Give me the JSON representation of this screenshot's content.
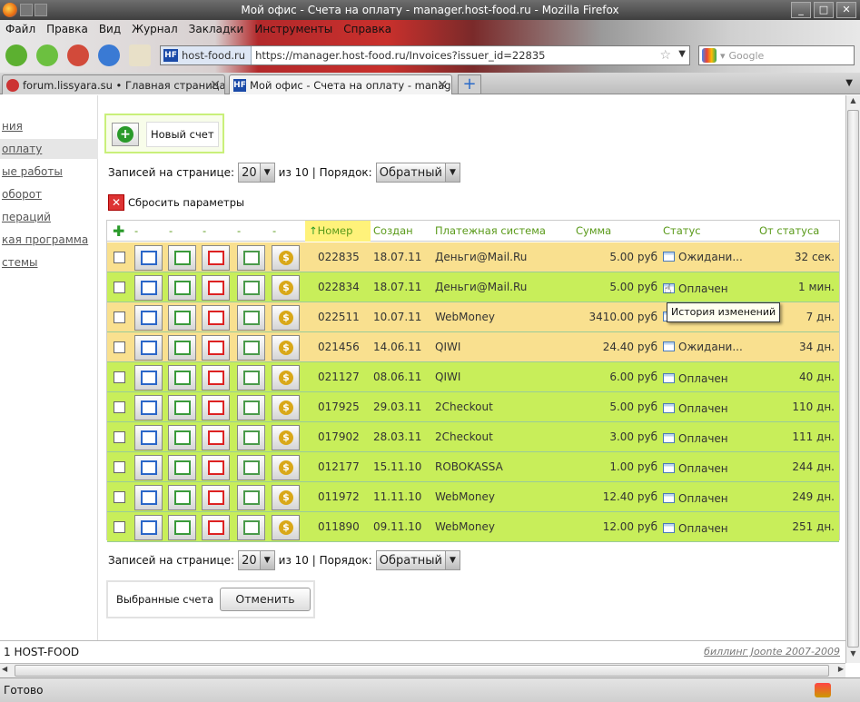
{
  "window": {
    "title": "Мой офис - Счета на оплату - manager.host-food.ru - Mozilla Firefox"
  },
  "menu": [
    "Файл",
    "Правка",
    "Вид",
    "Журнал",
    "Закладки",
    "Инструменты",
    "Справка"
  ],
  "urlbar": {
    "site": "host-food.ru",
    "url": "https://manager.host-food.ru/Invoices?issuer_id=22835"
  },
  "search": {
    "placeholder": "Google"
  },
  "tabs": [
    {
      "title": "forum.lissyara.su • Главная страница"
    },
    {
      "title": "Мой офис - Счета на оплату - manage..."
    }
  ],
  "sidebar": [
    "ния",
    "оплату",
    "ые работы",
    "оборот",
    "пераций",
    "кая программа",
    "стемы"
  ],
  "new_invoice": {
    "label": "Новый счет"
  },
  "pager": {
    "per_page_label": "Записей на странице:",
    "per_page": "20",
    "of": "из 10 | Порядок:",
    "order": "Обратный"
  },
  "reset": {
    "label": "Сбросить параметры"
  },
  "table": {
    "headers": {
      "c1": "-",
      "c2": "-",
      "c3": "-",
      "c4": "-",
      "c5": "-",
      "number": "Номер",
      "created": "Создан",
      "system": "Платежная система",
      "sum": "Сумма",
      "status": "Статус",
      "since": "От статуса"
    },
    "rows": [
      {
        "num": "022835",
        "date": "18.07.11",
        "system": "Деньги@Mail.Ru",
        "sum": "5.00 руб",
        "status": "Ожидани...",
        "since": "32 сек."
      },
      {
        "num": "022834",
        "date": "18.07.11",
        "system": "Деньги@Mail.Ru",
        "sum": "5.00 руб",
        "status": "Оплачен",
        "since": "1 мин."
      },
      {
        "num": "022511",
        "date": "10.07.11",
        "system": "WebMoney",
        "sum": "3410.00 руб",
        "status": "",
        "since": "7 дн."
      },
      {
        "num": "021456",
        "date": "14.06.11",
        "system": "QIWI",
        "sum": "24.40 руб",
        "status": "Ожидани...",
        "since": "34 дн."
      },
      {
        "num": "021127",
        "date": "08.06.11",
        "system": "QIWI",
        "sum": "6.00 руб",
        "status": "Оплачен",
        "since": "40 дн."
      },
      {
        "num": "017925",
        "date": "29.03.11",
        "system": "2Checkout",
        "sum": "5.00 руб",
        "status": "Оплачен",
        "since": "110 дн."
      },
      {
        "num": "017902",
        "date": "28.03.11",
        "system": "2Checkout",
        "sum": "3.00 руб",
        "status": "Оплачен",
        "since": "111 дн."
      },
      {
        "num": "012177",
        "date": "15.11.10",
        "system": "ROBOKASSA",
        "sum": "1.00 руб",
        "status": "Оплачен",
        "since": "244 дн."
      },
      {
        "num": "011972",
        "date": "11.11.10",
        "system": "WebMoney",
        "sum": "12.40 руб",
        "status": "Оплачен",
        "since": "249 дн."
      },
      {
        "num": "011890",
        "date": "09.11.10",
        "system": "WebMoney",
        "sum": "12.00 руб",
        "status": "Оплачен",
        "since": "251 дн."
      }
    ]
  },
  "tooltip": "История изменений",
  "selected": {
    "label": "Выбранные счета",
    "cancel": "Отменить"
  },
  "footer": {
    "left": "1 HOST-FOOD",
    "right": "биллинг Joonte 2007-2009"
  },
  "statusbar": "Готово",
  "colors": {
    "yellow_row": "#f9e08f",
    "green_row": "#c8ee5a",
    "header_text": "#5a9a1a"
  }
}
